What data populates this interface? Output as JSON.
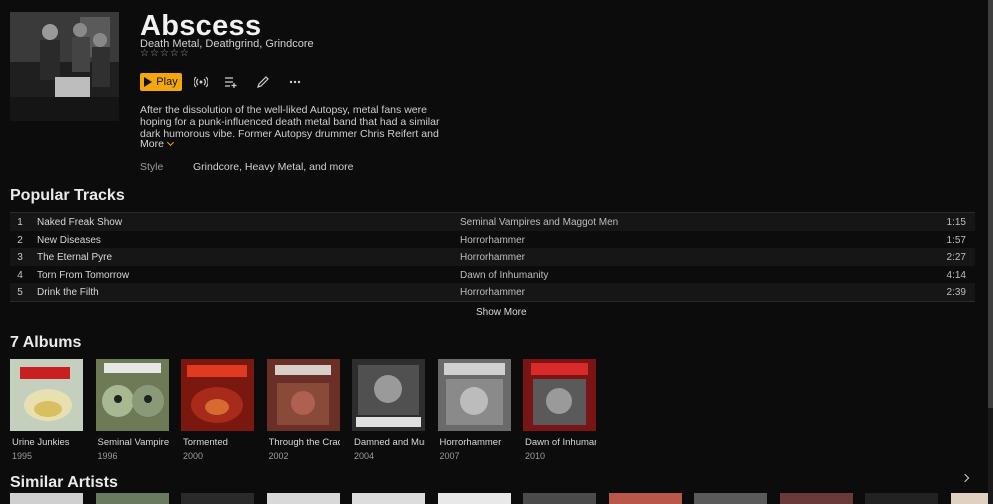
{
  "artist": {
    "name": "Abscess",
    "genres": "Death Metal, Deathgrind, Grindcore",
    "rating": 0,
    "rating_max": 5,
    "bio": "After the dissolution of the well-liked Autopsy, metal fans were hoping for a punk-influenced death metal band that had a similar dark humorous vibe. Former Autopsy drummer Chris Reifert and guitarist Danny Coralles decided to take that vision farther and added guitarist/bassist Clint Bower,",
    "more_label": "More",
    "style_label": "Style",
    "style_value": "Grindcore, Heavy Metal, and more"
  },
  "controls": {
    "play_label": "Play",
    "icons": [
      "radio-icon",
      "add-to-queue-icon",
      "edit-icon",
      "more-icon"
    ]
  },
  "popular_tracks": {
    "title": "Popular Tracks",
    "show_more_label": "Show More",
    "tracks": [
      {
        "num": "1",
        "title": "Naked Freak Show",
        "artist": "Seminal Vampires and Maggot Men",
        "duration": "1:15"
      },
      {
        "num": "2",
        "title": "New Diseases",
        "artist": "Horrorhammer",
        "duration": "1:57"
      },
      {
        "num": "3",
        "title": "The Eternal Pyre",
        "artist": "Horrorhammer",
        "duration": "2:27"
      },
      {
        "num": "4",
        "title": "Torn From Tomorrow",
        "artist": "Dawn of Inhumanity",
        "duration": "4:14"
      },
      {
        "num": "5",
        "title": "Drink the Filth",
        "artist": "Horrorhammer",
        "duration": "2:39"
      }
    ]
  },
  "albums": {
    "title": "7 Albums",
    "items": [
      {
        "title": "Urine Junkies",
        "year": "1995",
        "color": "#b9c7b4"
      },
      {
        "title": "Seminal Vampires and Maggot Men",
        "year": "1996",
        "color": "#6e7a55"
      },
      {
        "title": "Tormented",
        "year": "2000",
        "color": "#8a1c12"
      },
      {
        "title": "Through the Cracks of Death",
        "year": "2002",
        "color": "#7a3a30"
      },
      {
        "title": "Damned and Mummified",
        "year": "2004",
        "color": "#3c3c3c"
      },
      {
        "title": "Horrorhammer",
        "year": "2007",
        "color": "#777777"
      },
      {
        "title": "Dawn of Inhumanity",
        "year": "2010",
        "color": "#8e1a1a"
      }
    ]
  },
  "similar_artists": {
    "title": "Similar Artists",
    "thumb_colors": [
      "#cfcfcf",
      "#6a7a60",
      "#2a2a2a",
      "#d8d8d8",
      "#dcdcdc",
      "#e8e8e8",
      "#4a4a4a",
      "#b8574a",
      "#5a5a5a",
      "#6a3a3a",
      "#222222",
      "#e0d0c0"
    ]
  },
  "theme": {
    "accent": "#f2a80c",
    "background": "#0c0c0c"
  }
}
